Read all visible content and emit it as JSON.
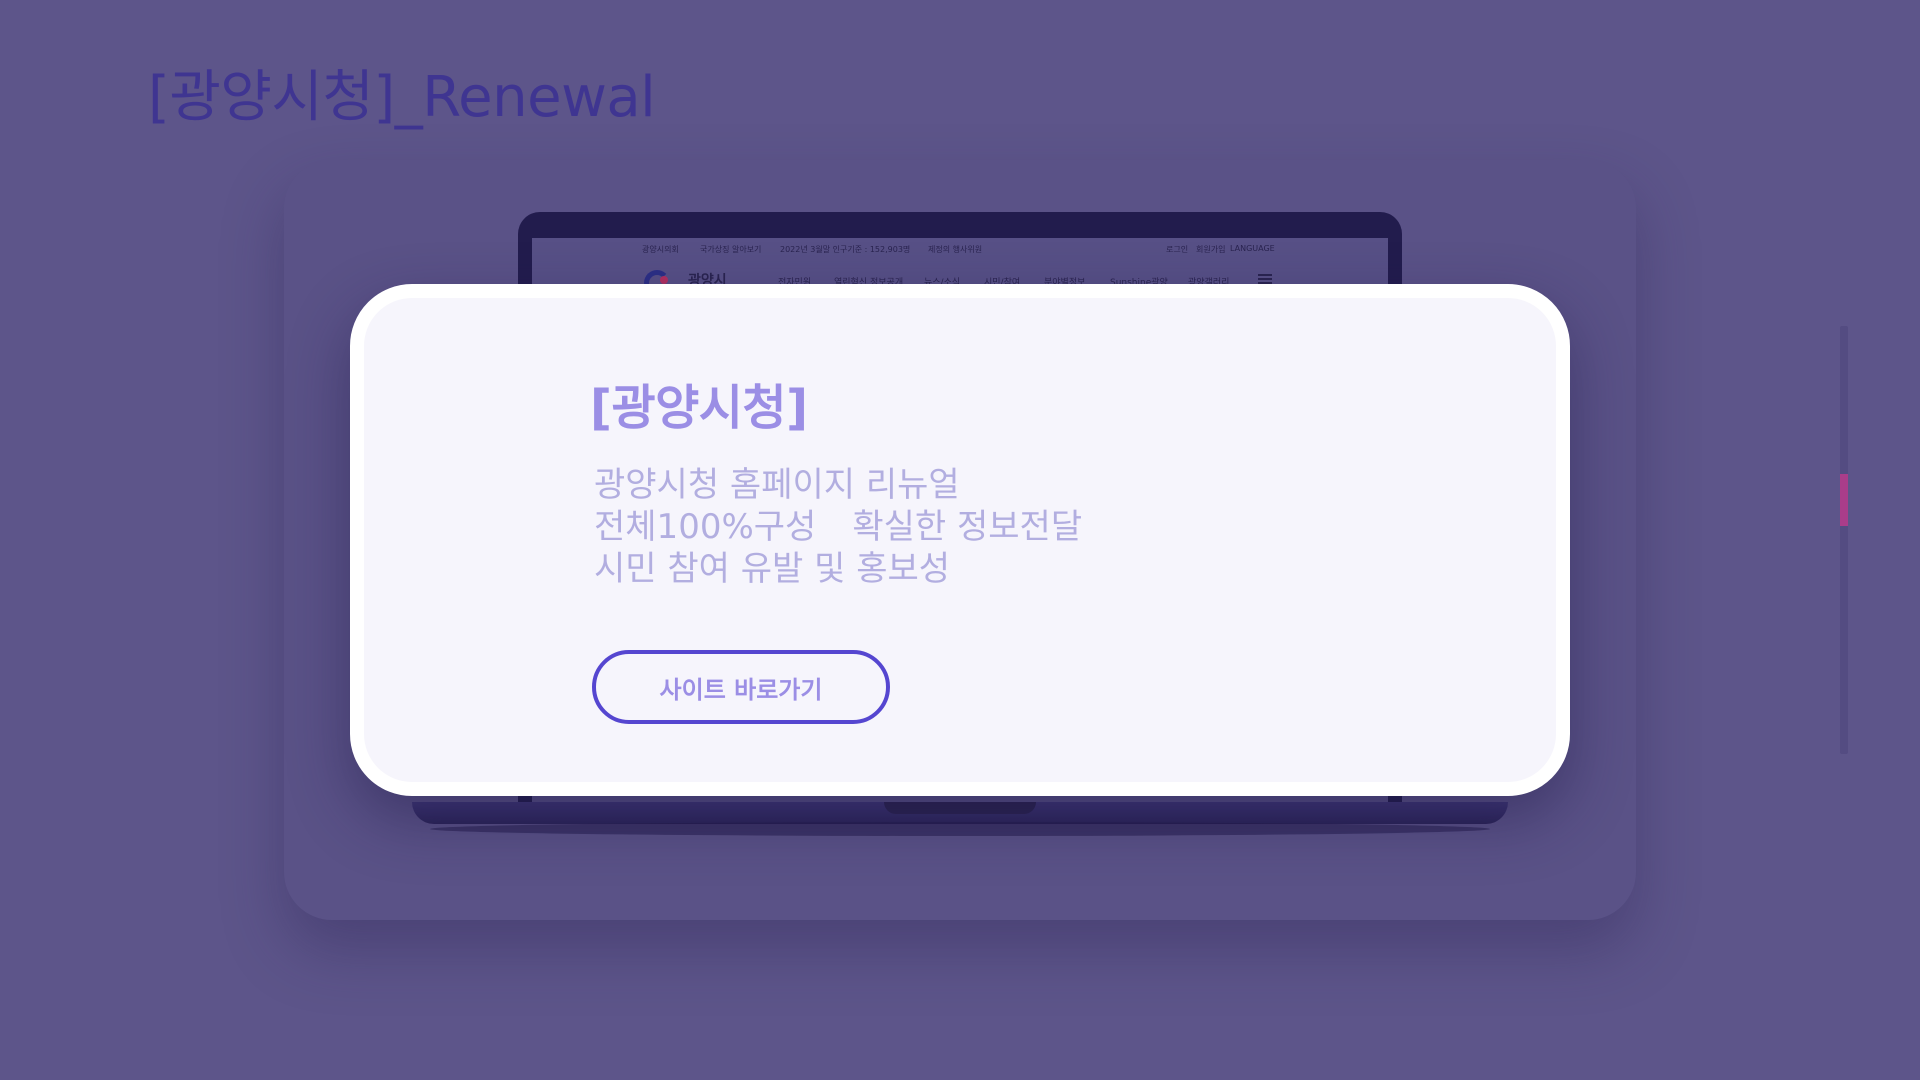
{
  "page": {
    "heading": "[광양시청]_Renewal"
  },
  "laptop_site": {
    "utility_bar": {
      "items": [
        "광양시의회",
        "국가상징 알아보기",
        "2022년 3월말 인구기준 : 152,903명",
        "제정의 행사위원"
      ],
      "right_items": [
        "로그인",
        "회원가입",
        "LANGUAGE"
      ]
    },
    "site_name": "광양시",
    "gnb": [
      "전자민원",
      "열린혁신 정보공개",
      "뉴스/소식",
      "시민/참여",
      "분야별정보",
      "Sunshine광양",
      "광양갤러리"
    ]
  },
  "card": {
    "title": "[광양시청]",
    "description": {
      "line1": "광양시청 홈페이지 리뉴얼",
      "line2a": "전체100%구성",
      "line2b": "확실한 정보전달",
      "line3": "시민 참여 유발 및 홍보성"
    },
    "cta_label": "사이트 바로가기"
  },
  "colors": {
    "background": "#5d558a",
    "heading": "#3f3591",
    "card_title": "#9b8ee5",
    "card_text": "#b2aee0",
    "button_border": "#5546d0",
    "scroll_accent": "#aa3d8a"
  },
  "icons": {
    "menu": "hamburger-icon",
    "logo": "city-logo-icon"
  },
  "scroll_position": 0.34
}
